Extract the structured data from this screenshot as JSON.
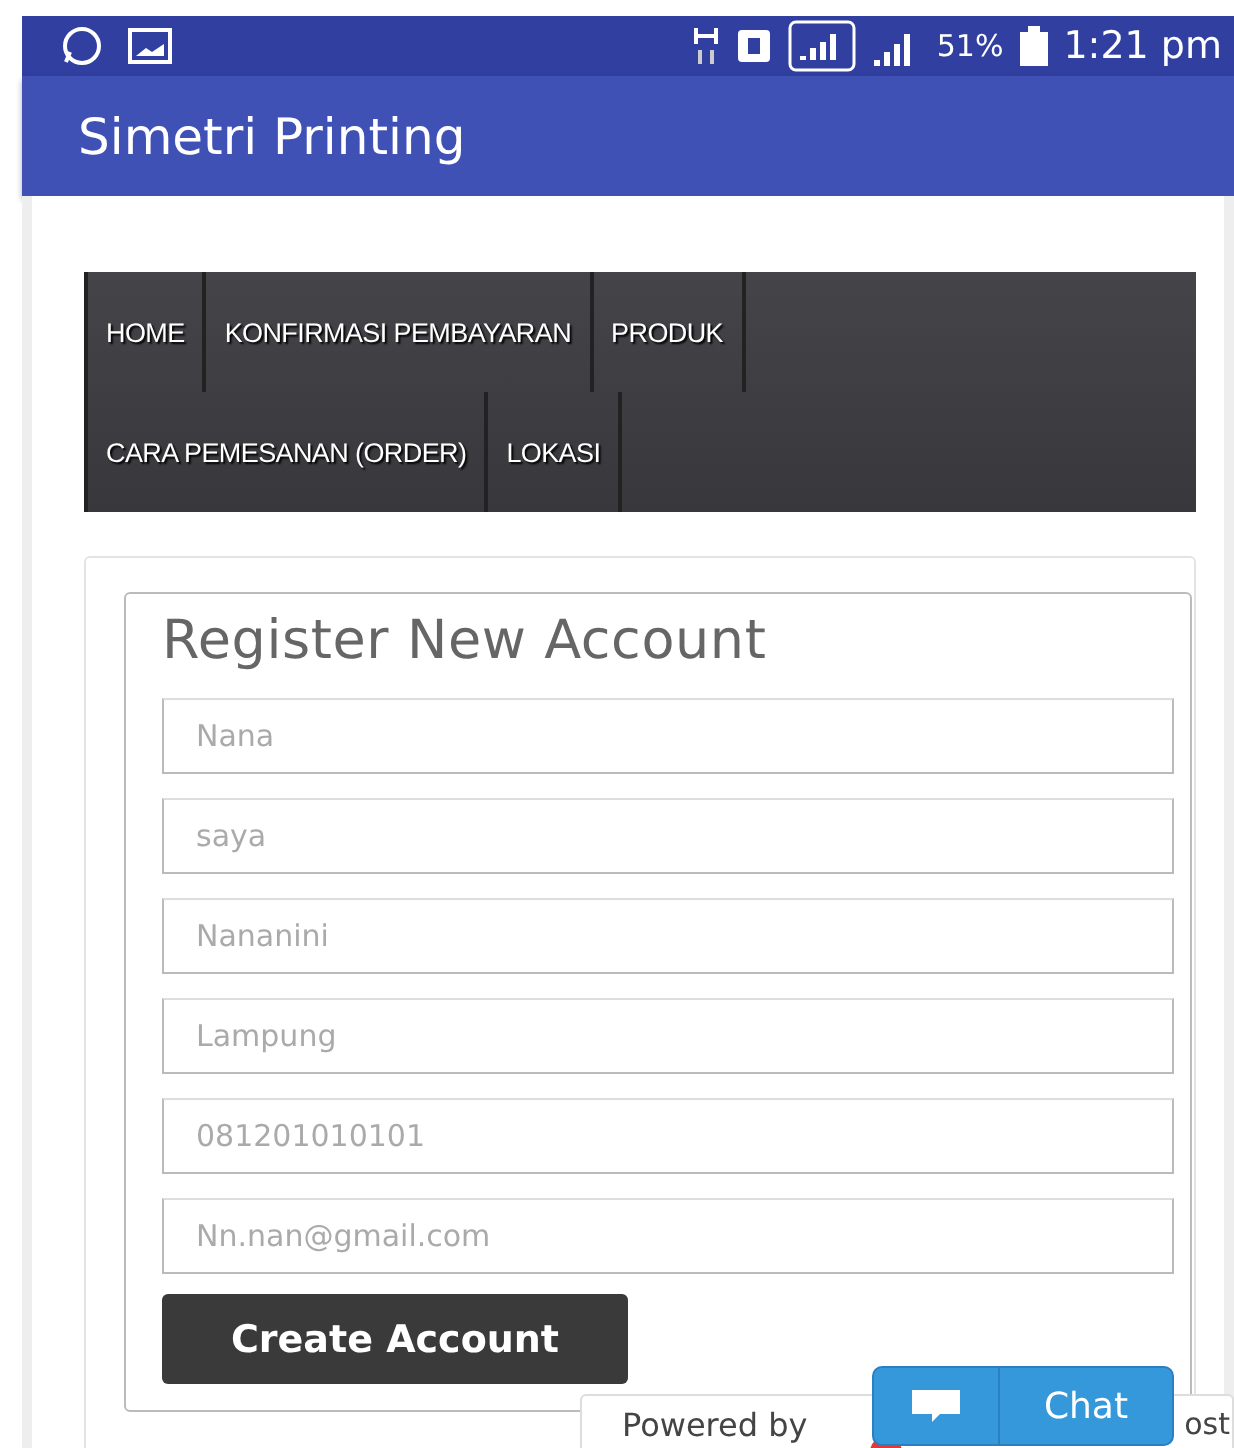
{
  "status_bar": {
    "battery": "51%",
    "time": "1:21 pm"
  },
  "app_bar": {
    "title": "Simetri Printing"
  },
  "nav": {
    "items": [
      {
        "label": "HOME"
      },
      {
        "label": "KONFIRMASI PEMBAYARAN"
      },
      {
        "label": "PRODUK"
      },
      {
        "label": "CARA PEMESANAN (ORDER)"
      },
      {
        "label": "LOKASI"
      }
    ]
  },
  "form": {
    "title": "Register New Account",
    "fields": [
      {
        "value": "Nana"
      },
      {
        "value": "saya"
      },
      {
        "value": "Nananini"
      },
      {
        "value": "Lampung"
      },
      {
        "value": "081201010101"
      },
      {
        "value": "Nn.nan@gmail.com"
      }
    ],
    "submit": "Create Account"
  },
  "footer": {
    "powered_by": "Powered by",
    "brand_fragment": "ost"
  },
  "chat": {
    "label": "Chat"
  }
}
